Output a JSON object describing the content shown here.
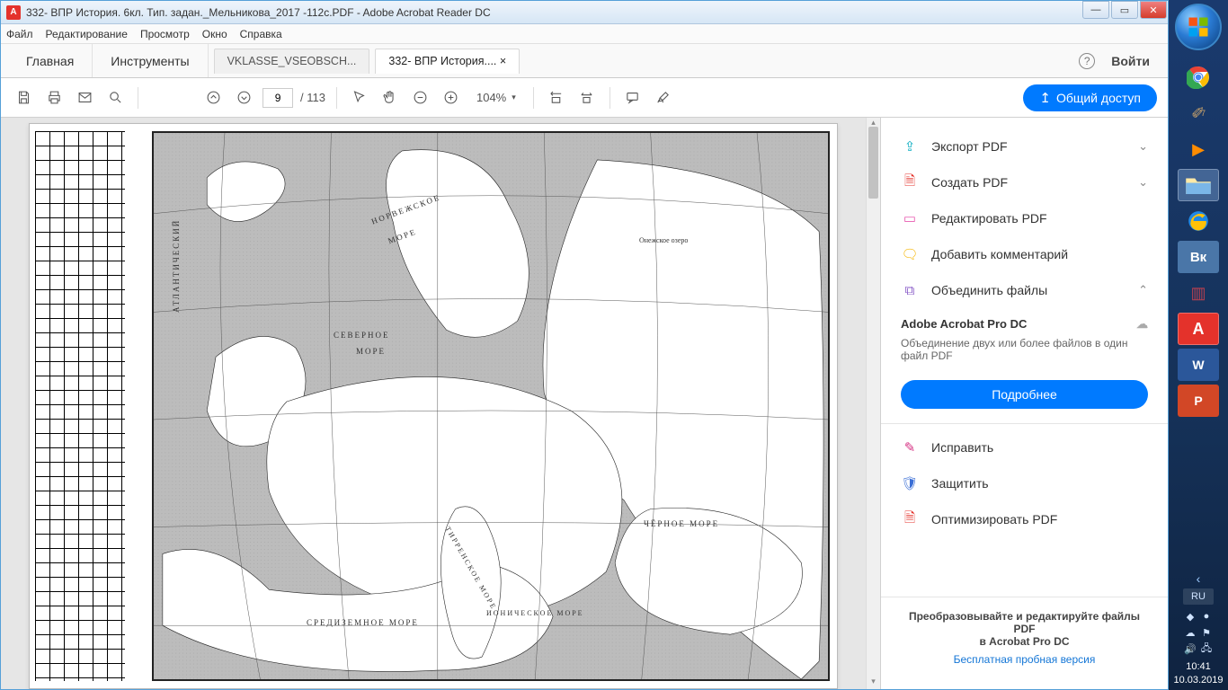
{
  "window": {
    "title": "332- ВПР История. 6кл. Тип. задан._Мельникова_2017 -112с.PDF - Adobe Acrobat Reader DC",
    "min": "—",
    "max": "▭",
    "close": "✕"
  },
  "menubar": [
    "Файл",
    "Редактирование",
    "Просмотр",
    "Окно",
    "Справка"
  ],
  "apptabs": {
    "home": "Главная",
    "tools": "Инструменты"
  },
  "doctabs": [
    {
      "label": "VKLASSE_VSEOBSCH...",
      "active": false
    },
    {
      "label": "332- ВПР История.... ×",
      "active": true
    }
  ],
  "login": "Войти",
  "toolbar": {
    "page_current": "9",
    "page_total": "/  113",
    "zoom": "104%",
    "share": "Общий доступ"
  },
  "map_labels": {
    "norwegian": "НОРВЕЖСКОЕ",
    "sea1": "МОРЕ",
    "north": "СЕВЕРНОЕ",
    "sea2": "МОРЕ",
    "atlantic": "АТЛАНТИЧЕСКИЙ",
    "med": "СРЕДИЗЕМНОЕ  МОРЕ",
    "black": "ЧЁРНОЕ  МОРЕ",
    "tyrr": "ТИРРЕНСКОЕ МОРЕ",
    "ion": "ИОНИЧЕСКОЕ МОРЕ",
    "onega": "Онежское озеро"
  },
  "right_panel": {
    "items": [
      {
        "icon": "⇪",
        "cls": "ic-export",
        "label": "Экспорт PDF",
        "chev": "⌄"
      },
      {
        "icon": "🗎",
        "cls": "ic-create",
        "label": "Создать PDF",
        "chev": "⌄"
      },
      {
        "icon": "▭",
        "cls": "ic-edit",
        "label": "Редактировать PDF",
        "chev": ""
      },
      {
        "icon": "🗨",
        "cls": "ic-comment",
        "label": "Добавить комментарий",
        "chev": ""
      },
      {
        "icon": "⧉",
        "cls": "ic-combine",
        "label": "Объединить файлы",
        "chev": "⌃"
      }
    ],
    "sub": {
      "title": "Adobe Acrobat Pro DC",
      "cloud": "☁",
      "desc": "Объединение двух или более файлов в один файл PDF",
      "btn": "Подробнее"
    },
    "items2": [
      {
        "icon": "✎",
        "cls": "ic-fix",
        "label": "Исправить"
      },
      {
        "icon": "🛡",
        "cls": "ic-protect",
        "label": "Защитить"
      },
      {
        "icon": "🗎",
        "cls": "ic-optimize",
        "label": "Оптимизировать PDF"
      }
    ],
    "footer": {
      "line1": "Преобразовывайте и редактируйте файлы PDF",
      "line2": "в Acrobat Pro DC",
      "trial": "Бесплатная пробная версия"
    }
  },
  "sidebar": {
    "lang": "RU",
    "time": "10:41",
    "date": "10.03.2019",
    "arrow": "‹"
  }
}
